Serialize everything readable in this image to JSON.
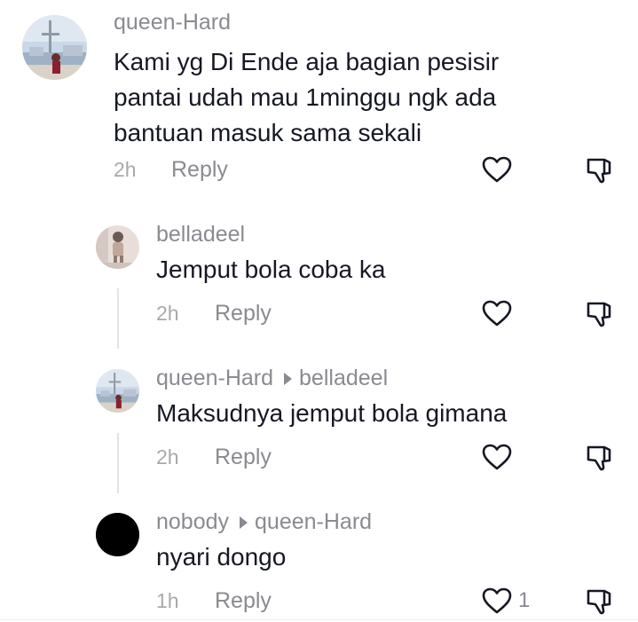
{
  "comments": [
    {
      "username": "queen-Hard",
      "reply_to": "",
      "text_lines": [
        "Kami yg Di Ende aja bagian pesisir",
        "pantai udah mau 1minggu ngk ada",
        "bantuan masuk sama sekali"
      ],
      "time": "2h",
      "reply_label": "Reply",
      "like_count": "",
      "avatar": "harbor-photo"
    },
    {
      "username": "belladeel",
      "reply_to": "",
      "text_lines": [
        "Jemput bola coba ka"
      ],
      "time": "2h",
      "reply_label": "Reply",
      "like_count": "",
      "avatar": "person-photo"
    },
    {
      "username": "queen-Hard",
      "reply_to": "belladeel",
      "text_lines": [
        "Maksudnya jemput bola gimana"
      ],
      "time": "2h",
      "reply_label": "Reply",
      "like_count": "",
      "avatar": "harbor-photo"
    },
    {
      "username": "nobody",
      "reply_to": "queen-Hard",
      "text_lines": [
        "nyari dongo"
      ],
      "time": "1h",
      "reply_label": "Reply",
      "like_count": "1",
      "avatar": "black-circle"
    }
  ],
  "icons": {
    "like": "heart-outline-icon",
    "dislike": "thumbs-down-icon",
    "reply_arrow": "triangle-right-icon"
  },
  "colors": {
    "text": "#161823",
    "secondary": "#8a8b91",
    "timestamp": "#a8a9ad"
  }
}
